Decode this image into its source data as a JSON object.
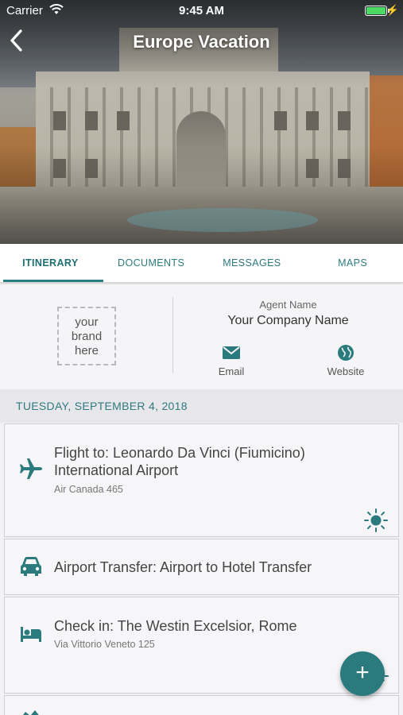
{
  "status_bar": {
    "carrier": "Carrier",
    "time": "9:45 AM"
  },
  "nav": {
    "title": "Europe Vacation",
    "back_icon": "chevron-left-icon"
  },
  "tabs": [
    {
      "label": "ITINERARY",
      "active": true
    },
    {
      "label": "DOCUMENTS",
      "active": false
    },
    {
      "label": "MESSAGES",
      "active": false
    },
    {
      "label": "MAPS",
      "active": false
    }
  ],
  "agent": {
    "brand_placeholder": [
      "your",
      "brand",
      "here"
    ],
    "label": "Agent Name",
    "company": "Your Company Name",
    "email_label": "Email",
    "website_label": "Website"
  },
  "itinerary": {
    "date": "TUESDAY, SEPTEMBER 4, 2018",
    "items": [
      {
        "icon": "airplane-icon",
        "title_line1": "Flight to: Leonardo Da Vinci (Fiumicino)",
        "title_line2": "International Airport",
        "subtitle": "Air Canada 465",
        "badge_icon": "sun-icon"
      },
      {
        "icon": "car-icon",
        "title_line1": "Airport Transfer: Airport to Hotel Transfer"
      },
      {
        "icon": "bed-icon",
        "title_line1": "Check in: The Westin Excelsior, Rome",
        "subtitle": "Via Vittorio Veneto 125",
        "badge_icon": "sun-icon"
      }
    ]
  },
  "fab": {
    "label": "+"
  },
  "colors": {
    "accent": "#2b7b7e",
    "battery": "#4cd964"
  }
}
